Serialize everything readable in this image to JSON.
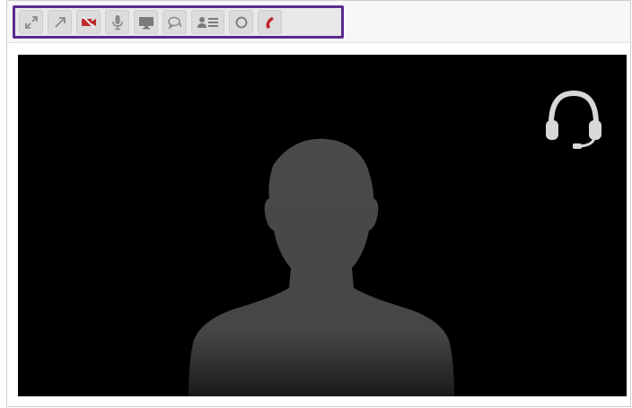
{
  "toolbar": {
    "buttons": [
      {
        "name": "fullscreen-button",
        "icon": "expand-arrows-icon"
      },
      {
        "name": "popout-button",
        "icon": "arrow-up-right-icon"
      },
      {
        "name": "camera-toggle-button",
        "icon": "video-off-icon",
        "color": "#c0282b"
      },
      {
        "name": "microphone-button",
        "icon": "microphone-icon"
      },
      {
        "name": "screen-share-button",
        "icon": "monitor-icon"
      },
      {
        "name": "chat-button",
        "icon": "chat-bubbles-icon"
      },
      {
        "name": "participants-button",
        "icon": "contact-list-icon"
      },
      {
        "name": "record-button",
        "icon": "circle-icon"
      },
      {
        "name": "hangup-button",
        "icon": "phone-hangup-icon",
        "color": "#c0282b"
      }
    ],
    "highlight_color": "#5b2a8f"
  },
  "video": {
    "background": "#000000",
    "overlay_icon": "headset-icon",
    "placeholder": "person-silhouette"
  }
}
